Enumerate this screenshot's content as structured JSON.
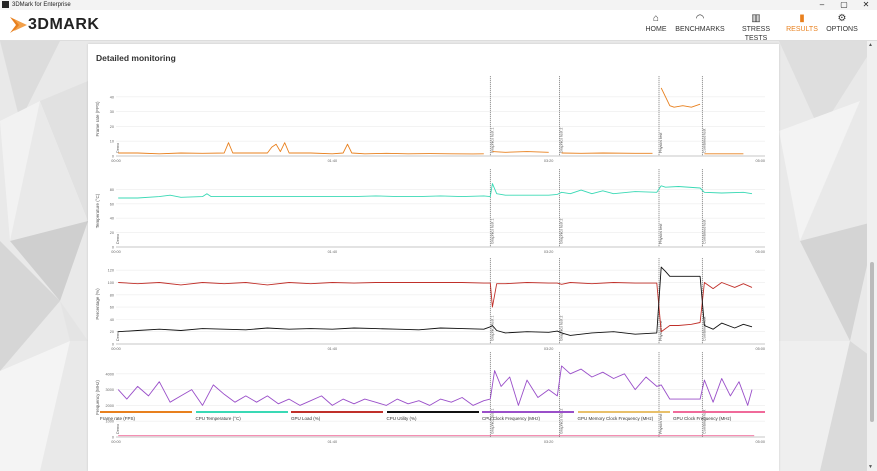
{
  "window": {
    "title": "3DMark for Enterprise",
    "controls": [
      "–",
      "▢",
      "✕"
    ]
  },
  "header": {
    "logo": "3DMARK",
    "nav": [
      {
        "label": "HOME",
        "icon": "home-icon",
        "glyph": "⌂",
        "active": false
      },
      {
        "label": "BENCHMARKS",
        "icon": "gauge-icon",
        "glyph": "◠",
        "active": false
      },
      {
        "label": "STRESS TESTS",
        "icon": "bar-chart-icon",
        "glyph": "▥",
        "active": false
      },
      {
        "label": "RESULTS",
        "icon": "results-icon",
        "glyph": "▮",
        "active": true
      },
      {
        "label": "OPTIONS",
        "icon": "gear-icon",
        "glyph": "⚙",
        "active": false
      }
    ]
  },
  "panel": {
    "title": "Detailed monitoring"
  },
  "colors": {
    "accent": "#e8801e",
    "frame_rate": "#e8801e",
    "cpu_temp": "#3ad9b5",
    "gpu_load": "#c0302a",
    "cpu_util": "#111111",
    "cpu_clock": "#9a4fc9",
    "gpu_mem_clock": "#e8c06a",
    "gpu_clock": "#f06a9a"
  },
  "chart_data": [
    {
      "type": "line",
      "ylabel": "Frame rate (FPS)",
      "yticks": [
        "0",
        "10",
        "20",
        "30",
        "40"
      ],
      "ylim": [
        0,
        50
      ],
      "xticks": [
        "00:00",
        "01:40",
        "03:20",
        "05:00"
      ],
      "xlim": [
        0,
        300
      ],
      "sections": [
        {
          "label": "Demo",
          "start": 0
        },
        {
          "label": "Graphics test 1",
          "start": 173
        },
        {
          "label": "Graphics test 2",
          "start": 205
        },
        {
          "label": "Physics test",
          "start": 251
        },
        {
          "label": "Combined test",
          "start": 271
        }
      ],
      "series": [
        {
          "name": "Frame rate (FPS)",
          "color": "#e8801e",
          "segments": [
            {
              "x": [
                1,
                10,
                20,
                30,
                40,
                50,
                52,
                54,
                56,
                60,
                70,
                72,
                74,
                76,
                78,
                80,
                90,
                100,
                105,
                107,
                109,
                115,
                125,
                135,
                145,
                155,
                165,
                170
              ],
              "y": [
                2,
                2,
                1.5,
                2,
                1.8,
                2,
                9,
                2,
                2,
                2,
                2,
                6,
                8,
                3,
                9,
                2,
                2,
                1.5,
                2,
                8,
                2,
                1.5,
                1.8,
                1.5,
                1.6,
                1.5,
                1.4,
                1.5
              ]
            },
            {
              "x": [
                174,
                180,
                190,
                200
              ],
              "y": [
                3,
                2.5,
                3,
                2.5
              ]
            },
            {
              "x": [
                206,
                215,
                225,
                240,
                248
              ],
              "y": [
                2,
                1.8,
                2,
                1.8,
                1.8
              ]
            },
            {
              "x": [
                252,
                254,
                256,
                258,
                262,
                266,
                270
              ],
              "y": [
                46,
                40,
                34,
                33,
                34,
                33,
                35
              ]
            },
            {
              "x": [
                272,
                280,
                290
              ],
              "y": [
                1.5,
                1.5,
                1.5
              ]
            }
          ]
        }
      ]
    },
    {
      "type": "line",
      "ylabel": "Temperature (°C)",
      "yticks": [
        "0",
        "20",
        "40",
        "60",
        "80"
      ],
      "ylim": [
        0,
        100
      ],
      "xticks": [
        "00:00",
        "01:40",
        "03:20",
        "05:00"
      ],
      "xlim": [
        0,
        300
      ],
      "sections": [
        {
          "label": "Demo",
          "start": 0
        },
        {
          "label": "Graphics test 1",
          "start": 173
        },
        {
          "label": "Graphics test 2",
          "start": 205
        },
        {
          "label": "Physics test",
          "start": 251
        },
        {
          "label": "Combined test",
          "start": 271
        }
      ],
      "series": [
        {
          "name": "CPU Temperature (°C)",
          "color": "#3ad9b5",
          "x": [
            1,
            10,
            20,
            25,
            30,
            40,
            42,
            44,
            50,
            60,
            70,
            80,
            90,
            100,
            110,
            120,
            130,
            140,
            150,
            160,
            170,
            173,
            174,
            176,
            180,
            190,
            200,
            204,
            206,
            210,
            215,
            220,
            225,
            230,
            240,
            250,
            252,
            254,
            260,
            270,
            272,
            280,
            290,
            294
          ],
          "y": [
            68,
            68,
            70,
            72,
            69,
            70,
            74,
            70,
            70,
            70,
            70,
            70,
            70,
            70,
            70,
            71,
            70,
            70,
            71,
            70,
            71,
            70,
            88,
            74,
            72,
            72,
            72,
            73,
            76,
            74,
            79,
            74,
            78,
            74,
            77,
            76,
            85,
            83,
            84,
            82,
            76,
            75,
            76,
            74
          ]
        }
      ]
    },
    {
      "type": "line",
      "ylabel": "Percentage (%)",
      "yticks": [
        "0",
        "20",
        "40",
        "60",
        "80",
        "100",
        "120"
      ],
      "ylim": [
        0,
        130
      ],
      "xticks": [
        "00:00",
        "01:40",
        "03:20",
        "05:00"
      ],
      "xlim": [
        0,
        300
      ],
      "sections": [
        {
          "label": "Demo",
          "start": 0
        },
        {
          "label": "Graphics test 1",
          "start": 173
        },
        {
          "label": "Graphics test 2",
          "start": 205
        },
        {
          "label": "Physics test",
          "start": 251
        },
        {
          "label": "Combined test",
          "start": 271
        }
      ],
      "series": [
        {
          "name": "GPU Load (%)",
          "color": "#c0302a",
          "x": [
            1,
            10,
            20,
            30,
            40,
            50,
            60,
            70,
            80,
            90,
            100,
            110,
            120,
            130,
            140,
            150,
            160,
            170,
            173,
            174,
            176,
            180,
            190,
            200,
            204,
            206,
            210,
            220,
            230,
            240,
            250,
            252,
            256,
            260,
            266,
            270,
            272,
            276,
            280,
            286,
            290,
            294
          ],
          "y": [
            100,
            98,
            100,
            96,
            100,
            98,
            100,
            96,
            100,
            98,
            100,
            99,
            100,
            100,
            100,
            100,
            100,
            99,
            99,
            60,
            98,
            98,
            100,
            99,
            99,
            97,
            100,
            98,
            100,
            99,
            99,
            20,
            30,
            30,
            32,
            35,
            100,
            90,
            100,
            92,
            98,
            92
          ]
        },
        {
          "name": "CPU Utility (%)",
          "color": "#111111",
          "x": [
            1,
            10,
            20,
            30,
            40,
            50,
            60,
            70,
            80,
            90,
            100,
            110,
            120,
            130,
            140,
            150,
            160,
            170,
            173,
            174,
            176,
            180,
            190,
            200,
            204,
            206,
            210,
            220,
            230,
            240,
            250,
            252,
            254,
            256,
            260,
            266,
            270,
            272,
            276,
            280,
            286,
            290,
            294
          ],
          "y": [
            20,
            22,
            24,
            22,
            25,
            24,
            23,
            26,
            24,
            25,
            24,
            26,
            25,
            24,
            23,
            26,
            25,
            24,
            28,
            30,
            22,
            18,
            20,
            19,
            21,
            18,
            14,
            18,
            20,
            16,
            18,
            125,
            118,
            110,
            110,
            110,
            110,
            30,
            24,
            34,
            26,
            32,
            28
          ]
        }
      ]
    },
    {
      "type": "line",
      "ylabel": "Frequency (MHz)",
      "yticks": [
        "0",
        "1000",
        "2000",
        "3000",
        "4000"
      ],
      "ylim": [
        0,
        5000
      ],
      "xticks": [
        "00:00",
        "01:40",
        "03:20",
        "05:00"
      ],
      "xlim": [
        0,
        300
      ],
      "sections": [
        {
          "label": "Demo",
          "start": 0
        },
        {
          "label": "Graphics test 1",
          "start": 173
        },
        {
          "label": "Graphics test 2",
          "start": 205
        },
        {
          "label": "Physics test",
          "start": 251
        },
        {
          "label": "Combined test",
          "start": 271
        }
      ],
      "series": [
        {
          "name": "CPU Clock Frequency (MHz)",
          "color": "#9a4fc9",
          "x": [
            1,
            5,
            10,
            15,
            20,
            25,
            30,
            35,
            40,
            45,
            50,
            55,
            60,
            65,
            70,
            75,
            80,
            85,
            90,
            95,
            100,
            105,
            110,
            115,
            120,
            125,
            130,
            135,
            140,
            145,
            150,
            155,
            160,
            165,
            170,
            173,
            175,
            178,
            182,
            186,
            190,
            195,
            200,
            204,
            206,
            210,
            215,
            220,
            225,
            230,
            235,
            240,
            245,
            250,
            252,
            256,
            262,
            270,
            272,
            276,
            280,
            284,
            288,
            292,
            294
          ],
          "y": [
            3000,
            2400,
            3200,
            2600,
            3500,
            2200,
            2600,
            3000,
            2000,
            3300,
            2700,
            2200,
            2600,
            2200,
            2600,
            2100,
            2400,
            2000,
            2300,
            2600,
            2000,
            2400,
            2100,
            2400,
            2200,
            2000,
            2400,
            2100,
            2300,
            2000,
            2400,
            2200,
            2500,
            2000,
            2300,
            2400,
            4200,
            3200,
            3800,
            2000,
            3600,
            2500,
            3000,
            2600,
            4500,
            4000,
            4300,
            3800,
            4100,
            3700,
            4000,
            3000,
            3800,
            3200,
            3300,
            2400,
            2400,
            2400,
            3600,
            2200,
            3700,
            2600,
            3500,
            2000,
            3000
          ]
        },
        {
          "name": "GPU Clock Frequency (MHz)",
          "color": "#f06a9a",
          "x": [
            1,
            295
          ],
          "y": [
            80,
            80
          ]
        }
      ]
    }
  ],
  "legend": [
    {
      "label": "Frame rate (FPS)",
      "color": "#e8801e"
    },
    {
      "label": "CPU Temperature (°C)",
      "color": "#3ad9b5"
    },
    {
      "label": "GPU Load (%)",
      "color": "#c0302a"
    },
    {
      "label": "CPU Utility (%)",
      "color": "#111111"
    },
    {
      "label": "CPU Clock Frequency (MHz)",
      "color": "#9a4fc9"
    },
    {
      "label": "GPU Memory Clock Frequency (MHz)",
      "color": "#e8c06a"
    },
    {
      "label": "GPU Clock Frequency (MHz)",
      "color": "#f06a9a"
    }
  ]
}
